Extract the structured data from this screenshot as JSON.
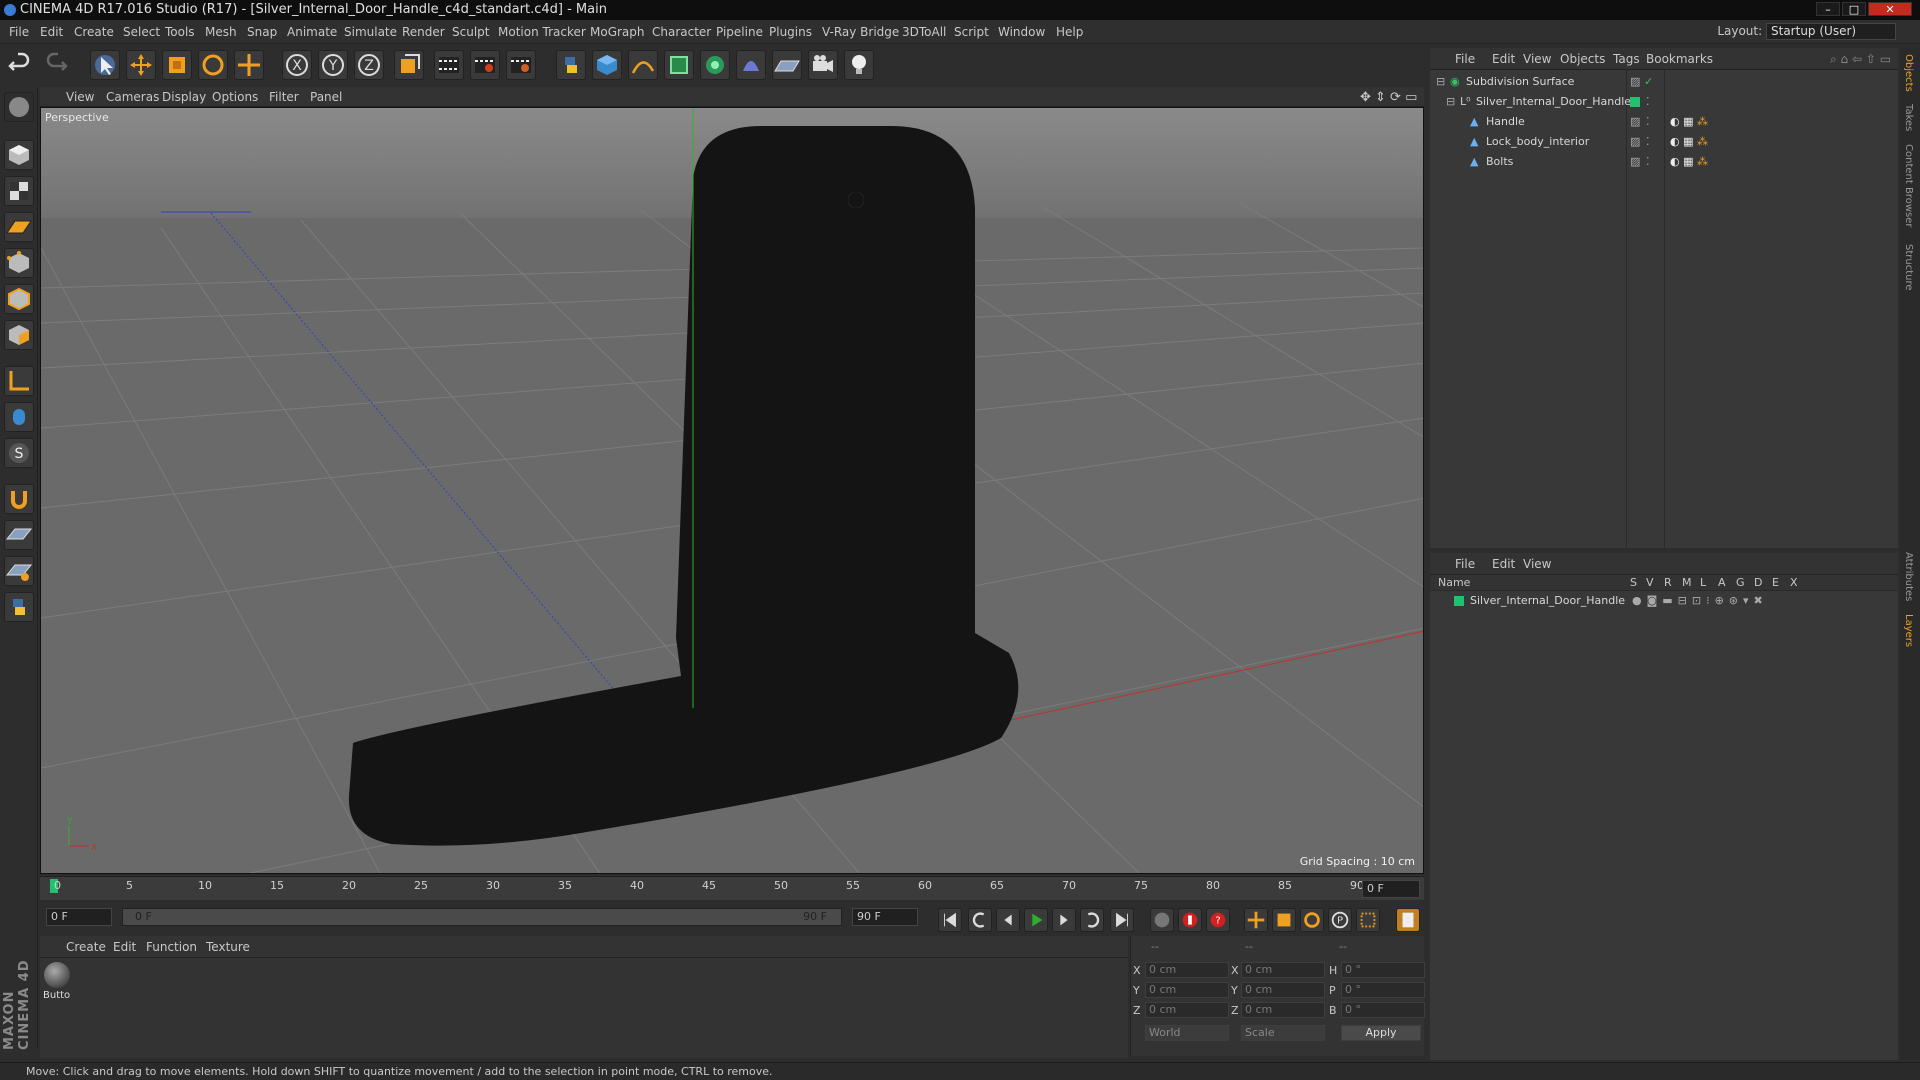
{
  "window": {
    "title": "CINEMA 4D R17.016 Studio (R17) - [Silver_Internal_Door_Handle_c4d_standart.c4d] - Main",
    "min": "–",
    "max": "□",
    "close": "✕"
  },
  "menubar": {
    "items": [
      "File",
      "Edit",
      "Create",
      "Select",
      "Tools",
      "Mesh",
      "Snap",
      "Animate",
      "Simulate",
      "Render",
      "Sculpt",
      "Motion Tracker",
      "MoGraph",
      "Character",
      "Pipeline",
      "Plugins",
      "V-Ray Bridge",
      "3DToAll",
      "Script",
      "Window",
      "Help"
    ],
    "layout_label": "Layout:",
    "layout_value": "Startup (User)"
  },
  "viewport": {
    "menu": [
      "View",
      "Cameras",
      "Display",
      "Options",
      "Filter",
      "Panel"
    ],
    "camera_label": "Perspective",
    "grid_spacing": "Grid Spacing : 10 cm"
  },
  "timeline": {
    "ticks": [
      "0",
      "5",
      "10",
      "15",
      "20",
      "25",
      "30",
      "35",
      "40",
      "45",
      "50",
      "55",
      "60",
      "65",
      "70",
      "75",
      "80",
      "85",
      "90"
    ],
    "current_frame": "0 F",
    "start_field": "0 F",
    "range_start": "0 F",
    "range_end": "90 F",
    "end_field": "90 F"
  },
  "material_manager": {
    "menu": [
      "Create",
      "Edit",
      "Function",
      "Texture"
    ],
    "material_name": "Butto"
  },
  "coordinates": {
    "headers": [
      "--",
      "--",
      "--"
    ],
    "rows": [
      {
        "axis": "X",
        "pos": "0 cm",
        "axis2": "X",
        "size": "0 cm",
        "rot_label": "H",
        "rot": "0 °"
      },
      {
        "axis": "Y",
        "pos": "0 cm",
        "axis2": "Y",
        "size": "0 cm",
        "rot_label": "P",
        "rot": "0 °"
      },
      {
        "axis": "Z",
        "pos": "0 cm",
        "axis2": "Z",
        "size": "0 cm",
        "rot_label": "B",
        "rot": "0 °"
      }
    ],
    "space": "World",
    "mode": "Scale",
    "apply": "Apply"
  },
  "object_manager": {
    "menu": [
      "File",
      "Edit",
      "View",
      "Objects",
      "Tags",
      "Bookmarks"
    ],
    "objects": [
      {
        "name": "Subdivision Surface",
        "indent": 0
      },
      {
        "name": "Silver_Internal_Door_Handle",
        "indent": 1
      },
      {
        "name": "Handle",
        "indent": 2
      },
      {
        "name": "Lock_body_interior",
        "indent": 2
      },
      {
        "name": "Bolts",
        "indent": 2
      }
    ]
  },
  "layers_manager": {
    "menu": [
      "File",
      "Edit",
      "View"
    ],
    "columns": [
      "Name",
      "S",
      "V",
      "R",
      "M",
      "L",
      "A",
      "G",
      "D",
      "E",
      "X"
    ],
    "layer_name": "Silver_Internal_Door_Handle"
  },
  "right_tabs": [
    "Objects",
    "Takes",
    "Content Browser",
    "Structure",
    "Attributes",
    "Layers"
  ],
  "status": "Move: Click and drag to move elements. Hold down SHIFT to quantize movement / add to the selection in point mode, CTRL to remove.",
  "maxon_logo": "MAXON CINEMA 4D",
  "colors": {
    "layer_green": "#22c070",
    "axis_red": "#c03030",
    "axis_green": "#30b030",
    "axis_blue": "#3040c0"
  }
}
